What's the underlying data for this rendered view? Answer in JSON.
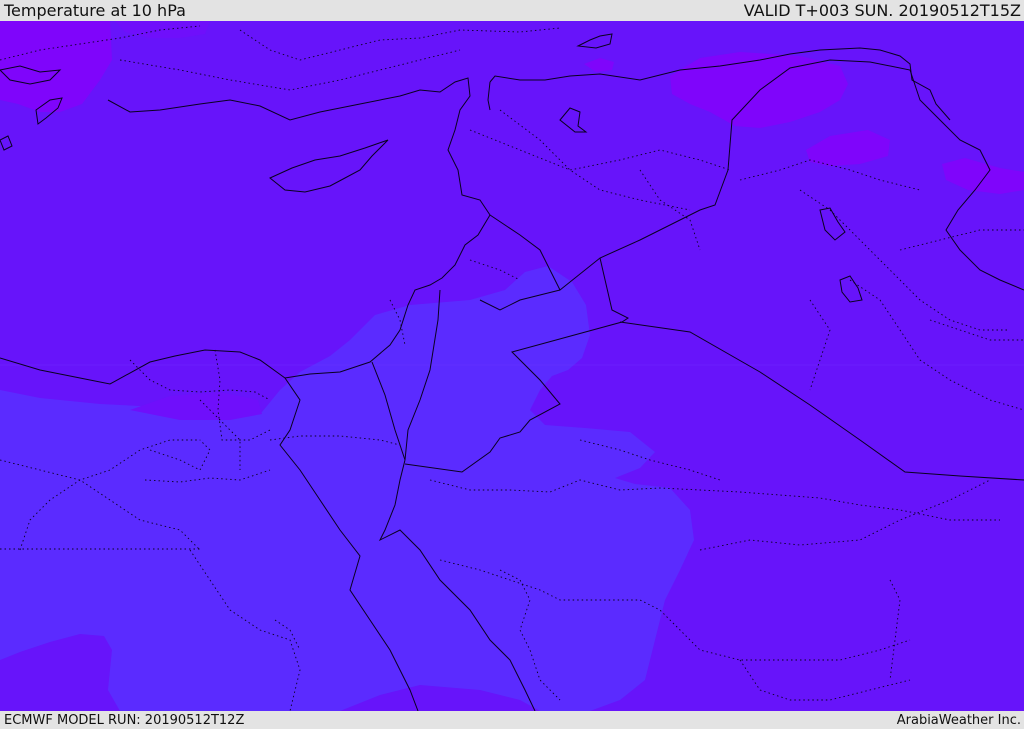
{
  "header": {
    "title": "Temperature at 10 hPa",
    "valid": "VALID T+003 SUN. 20190512T15Z"
  },
  "footer": {
    "model_run": "ECMWF MODEL RUN: 20190512T12Z",
    "credit": "ArabiaWeather Inc."
  },
  "colors": {
    "base": "#6714fa",
    "cool": "#5b2bff",
    "warm": "#7f05fb",
    "border": "#0a0020",
    "frame": "#e3e3e3"
  }
}
